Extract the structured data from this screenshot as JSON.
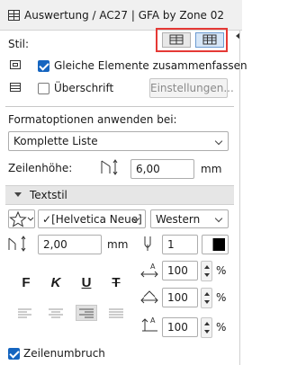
{
  "window": {
    "title": "Auswertung / AC27 | GFA by Zone 02"
  },
  "style_row": {
    "label": "Stil:"
  },
  "merge_row": {
    "label": "Gleiche Elemente zusammenfassen",
    "checked": true
  },
  "heading_row": {
    "label": "Überschrift",
    "checked": false,
    "settings_button": "Einstellungen..."
  },
  "format_options": {
    "label": "Formatoptionen anwenden bei:",
    "value": "Komplette Liste"
  },
  "row_height": {
    "label": "Zeilenhöhe:",
    "value": "6,00",
    "unit": "mm"
  },
  "text_style": {
    "section_title": "Textstil",
    "font": "[Helvetica Neue]",
    "script": "Western",
    "size": "2,00",
    "size_unit": "mm",
    "pen": "1",
    "style_buttons": [
      "F",
      "K",
      "U",
      "T"
    ],
    "width_pct": "100",
    "spacing_pct": "100",
    "slant_pct": "100",
    "pct_unit": "%"
  },
  "wrap": {
    "label": "Zeilenumbruch",
    "checked": true
  },
  "colors": {
    "accent": "#1565c0",
    "highlight": "#e53935",
    "panel": "#f0f0f0"
  }
}
